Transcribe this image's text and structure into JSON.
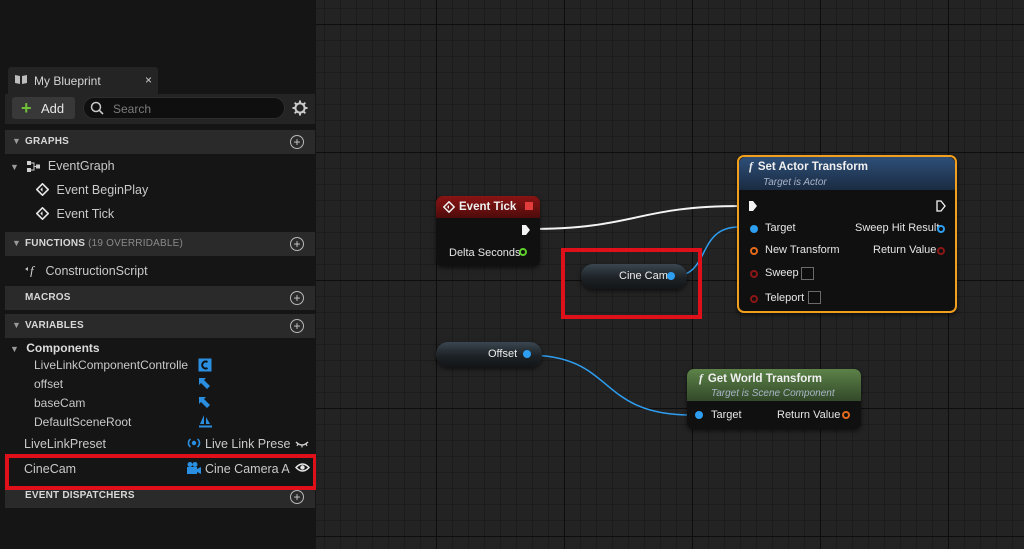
{
  "my_blueprint": {
    "tab_title": "My Blueprint",
    "tab_close": "×",
    "add_label": "Add",
    "search_placeholder": "Search",
    "sections": {
      "graphs": "GRAPHS",
      "functions": "FUNCTIONS",
      "functions_sub": "(19 OVERRIDABLE)",
      "macros": "MACROS",
      "variables": "VARIABLES",
      "event_dispatchers": "EVENT DISPATCHERS"
    },
    "graphs": {
      "event_graph": "EventGraph",
      "events": [
        "Event BeginPlay",
        "Event Tick"
      ]
    },
    "functions": [
      "ConstructionScript"
    ],
    "components_label": "Components",
    "components": [
      {
        "name": "LiveLinkComponentControlle",
        "icon": "livelink-component-icon"
      },
      {
        "name": "offset",
        "icon": "scene-arrow-icon"
      },
      {
        "name": "baseCam",
        "icon": "scene-arrow-icon"
      },
      {
        "name": "DefaultSceneRoot",
        "icon": "scene-root-icon"
      }
    ],
    "variables": [
      {
        "name": "LiveLinkPreset",
        "type": "Live Link Prese",
        "icon": "livelink-icon"
      },
      {
        "name": "CineCam",
        "type": "Cine Camera A",
        "icon": "camera-icon"
      }
    ]
  },
  "graph": {
    "event_tick": {
      "title": "Event Tick",
      "pin": "Delta Seconds"
    },
    "cine_cam_var": "Cine Cam",
    "offset_var": "Offset",
    "set_actor_transform": {
      "title": "Set Actor Transform",
      "subtitle": "Target is Actor",
      "inputs": [
        "Target",
        "New Transform",
        "Sweep",
        "Teleport"
      ],
      "outputs": [
        "Sweep Hit Result",
        "Return Value"
      ]
    },
    "get_world_transform": {
      "title": "Get World Transform",
      "subtitle": "Target is Scene Component",
      "input": "Target",
      "output": "Return Value"
    }
  },
  "colors": {
    "highlight": "#e0101a",
    "event_header": "#7a1212",
    "function_header": "#2c4c72",
    "pure_function_header": "#4a6d3c",
    "selected_border": "#f0a01e",
    "object_pin": "#2e9ef0",
    "struct_pin": "#e46a1b",
    "bool_pin": "#8a1616",
    "float_pin": "#5fcf2b"
  }
}
